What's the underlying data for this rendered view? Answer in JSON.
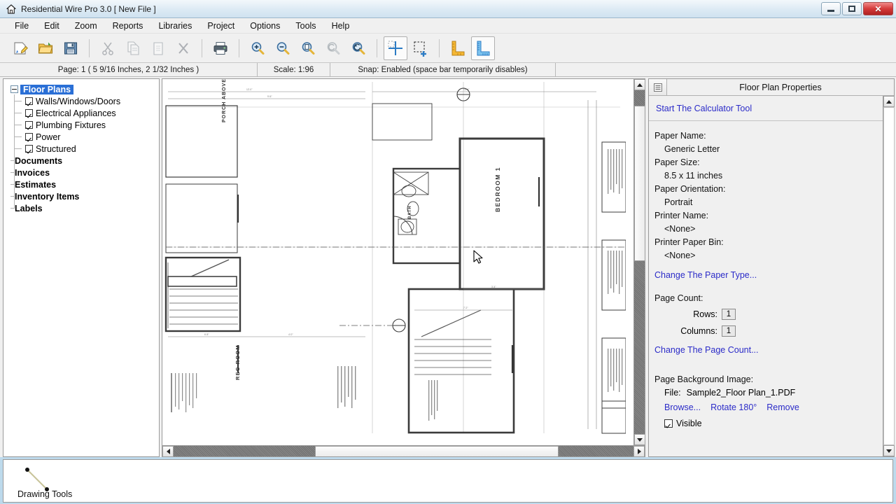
{
  "window": {
    "title": "Residential Wire Pro 3.0 [ New File ]",
    "app_icon": "home-icon",
    "controls": {
      "minimize": "minimize-icon",
      "maximize": "maximize-icon",
      "close": "close-icon"
    }
  },
  "menu": {
    "items": [
      "File",
      "Edit",
      "Zoom",
      "Reports",
      "Libraries",
      "Project",
      "Options",
      "Tools",
      "Help"
    ]
  },
  "toolbar": {
    "groups": [
      {
        "buttons": [
          {
            "name": "new-file-icon",
            "title": "New"
          },
          {
            "name": "open-file-icon",
            "title": "Open"
          },
          {
            "name": "save-file-icon",
            "title": "Save"
          }
        ]
      },
      {
        "buttons": [
          {
            "name": "cut-icon",
            "title": "Cut",
            "disabled": true
          },
          {
            "name": "copy-icon",
            "title": "Copy",
            "disabled": true
          },
          {
            "name": "paste-icon",
            "title": "Paste",
            "disabled": true
          },
          {
            "name": "delete-icon",
            "title": "Delete",
            "disabled": true
          }
        ]
      },
      {
        "buttons": [
          {
            "name": "print-icon",
            "title": "Print"
          }
        ]
      },
      {
        "buttons": [
          {
            "name": "zoom-in-icon",
            "title": "Zoom In"
          },
          {
            "name": "zoom-out-icon",
            "title": "Zoom Out"
          },
          {
            "name": "zoom-page-icon",
            "title": "Zoom Page"
          },
          {
            "name": "zoom-previous-icon",
            "title": "Zoom Previous",
            "disabled": true
          },
          {
            "name": "zoom-selection-icon",
            "title": "Zoom Selection"
          }
        ]
      },
      {
        "buttons": [
          {
            "name": "crosshair-tool-icon",
            "title": "Crosshair",
            "selected": true
          },
          {
            "name": "select-area-tool-icon",
            "title": "Add Area"
          }
        ]
      },
      {
        "buttons": [
          {
            "name": "ruler-orange-icon",
            "title": "Measure"
          },
          {
            "name": "ruler-blue-icon",
            "title": "Scale Ruler",
            "selected": true
          }
        ]
      }
    ]
  },
  "status": {
    "page": "Page: 1   ( 5 9/16 Inches, 2 1/32 Inches )",
    "scale": "Scale: 1:96",
    "snap": "Snap: Enabled  (space bar temporarily disables)"
  },
  "tree": {
    "root": {
      "label": "Floor Plans",
      "selected": true,
      "expanded": true
    },
    "children": [
      {
        "label": "Walls/Windows/Doors",
        "checked": true
      },
      {
        "label": "Electrical Appliances",
        "checked": true
      },
      {
        "label": "Plumbing Fixtures",
        "checked": true
      },
      {
        "label": "Power",
        "checked": true
      },
      {
        "label": "Structured",
        "checked": true
      }
    ],
    "siblings": [
      {
        "label": "Documents"
      },
      {
        "label": "Invoices"
      },
      {
        "label": "Estimates"
      },
      {
        "label": "Inventory Items"
      },
      {
        "label": "Labels"
      }
    ]
  },
  "properties": {
    "header_button_icon": "properties-list-icon",
    "title": "Floor Plan Properties",
    "calculator_link": "Start The Calculator Tool",
    "fields": [
      {
        "label": "Paper Name:",
        "value": "Generic Letter"
      },
      {
        "label": "Paper Size:",
        "value": "8.5 x 11 inches"
      },
      {
        "label": "Paper Orientation:",
        "value": "Portrait"
      },
      {
        "label": "Printer Name:",
        "value": "<None>"
      },
      {
        "label": "Printer Paper Bin:",
        "value": "<None>"
      }
    ],
    "change_paper_link": "Change The Paper Type...",
    "page_count_label": "Page Count:",
    "rows_label": "Rows:",
    "rows_value": "1",
    "columns_label": "Columns:",
    "columns_value": "1",
    "change_page_count_link": "Change The Page Count...",
    "background_label": "Page Background Image:",
    "file_label": "File:",
    "file_name": "Sample2_Floor Plan_1.PDF",
    "browse_link": "Browse...",
    "rotate_link": "Rotate 180°",
    "remove_link": "Remove",
    "visible_label": "Visible",
    "visible_checked": true
  },
  "drawing_tools": {
    "label": "Drawing Tools",
    "tool_icon": "line-tool-icon"
  },
  "canvas": {
    "rooms": [
      "PORCH ABOVE",
      "BEDROOM 1",
      "BATH",
      "REC ROOM"
    ],
    "cursor": "arrow-cursor"
  },
  "colors": {
    "accent_blue": "#2a6fd6",
    "link_blue": "#2b2bc8",
    "titlebar": "#dceaf4",
    "toolbar_bg": "#f0f0f0",
    "close_red": "#d43b3b",
    "window_frame": "#a8cfe8"
  }
}
